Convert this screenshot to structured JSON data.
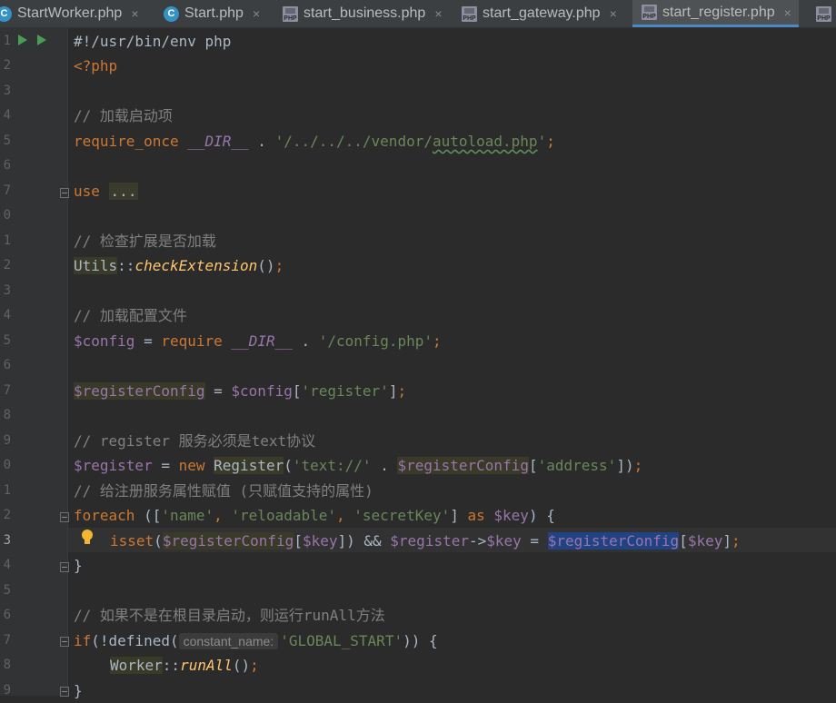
{
  "tabs": [
    {
      "label": "StartWorker.php",
      "icon": "php-class-icon",
      "active": false
    },
    {
      "label": "Start.php",
      "icon": "php-class-icon",
      "active": false
    },
    {
      "label": "start_business.php",
      "icon": "php-file-icon",
      "active": false
    },
    {
      "label": "start_gateway.php",
      "icon": "php-file-icon",
      "active": false
    },
    {
      "label": "start_register.php",
      "icon": "php-file-icon",
      "active": true
    }
  ],
  "tab_close_glyph": "×",
  "class_icon_letter": "C",
  "php_icon_text": "PHP",
  "line_numbers": [
    "1",
    "2",
    "3",
    "4",
    "5",
    "6",
    "7",
    "0",
    "1",
    "2",
    "3",
    "4",
    "5",
    "6",
    "7",
    "8",
    "9",
    "0",
    "1",
    "2",
    "3",
    "4",
    "5",
    "6",
    "7",
    "8",
    "9"
  ],
  "hint_label": "constant_name:",
  "code": {
    "l1": "#!/usr/bin/env php",
    "l2": "<?php",
    "l4": "// 加载启动项",
    "l5_kw": "require_once",
    "l5_const": "__DIR__",
    "l5_dot": " . ",
    "l5_str_a": "'/../../../vendor/",
    "l5_str_b": "autoload.php",
    "l5_str_c": "'",
    "semicolon": ";",
    "l7_kw": "use",
    "l7_ell": "...",
    "l9": "// 检查扩展是否加载",
    "l10_cls": "Utils",
    "dcolon": "::",
    "l10_fn": "checkExtension",
    "parens": "()",
    "l12": "// 加载配置文件",
    "v_config": "$config",
    "assign": " = ",
    "l13_kw": "require",
    "l13_str": "'/config.php'",
    "v_regcfg": "$registerConfig",
    "l15_br_open": "[",
    "l15_str": "'register'",
    "l15_br_close": "]",
    "l17": "// register 服务必须是text协议",
    "v_register": "$register",
    "kw_new": "new",
    "l18_cls": "Register",
    "paren_open": "(",
    "l18_str": "'text://'",
    "l18_str2": "'address'",
    "l18_close": "])",
    "l19": "// 给注册服务属性赋值 (只赋值支持的属性)",
    "kw_foreach": "foreach",
    "l20_open": " ([",
    "l20_s1": "'name'",
    "comma": ", ",
    "l20_s2": "'reloadable'",
    "l20_s3": "'secretKey'",
    "l20_close": "] ",
    "kw_as": "as",
    "v_key": "$key",
    "l20_end": ") {",
    "l21_fn": "isset",
    "l21_mid": "]) && ",
    "arrow": "->",
    "brace_close": "}",
    "l24": "// 如果不是在根目录启动，则运行runAll方法",
    "kw_if": "if",
    "l25_fn": "(!defined(",
    "l25_str": "'GLOBAL_START'",
    "l25_end": ")) {",
    "l26_cls": "Worker",
    "l26_fn": "runAll"
  }
}
